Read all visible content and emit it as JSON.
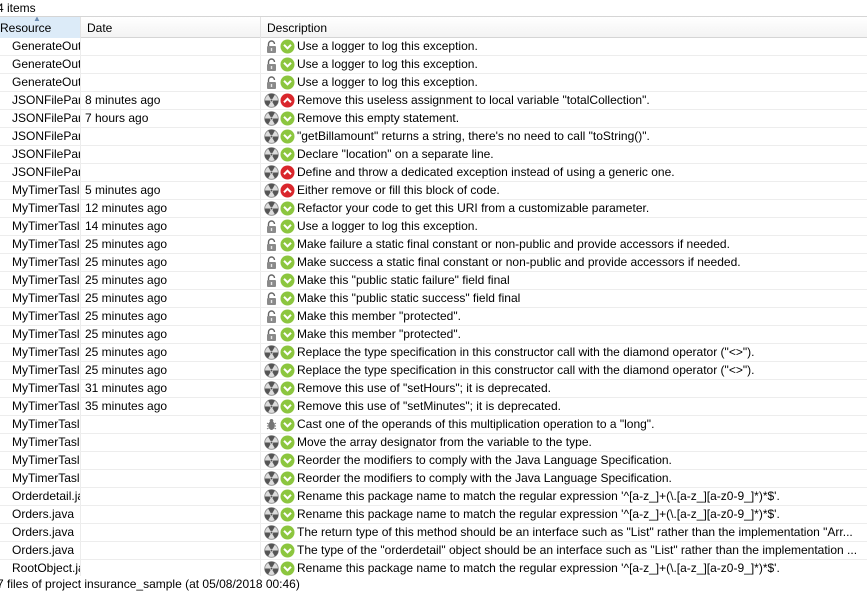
{
  "item_count": "4 items",
  "columns": {
    "resource": "Resource",
    "date": "Date",
    "description": "Description"
  },
  "rows": [
    {
      "resource": "GenerateOut",
      "date": "",
      "type": "lock-icon",
      "severity": "minor",
      "description": "Use a logger to log this exception."
    },
    {
      "resource": "GenerateOut",
      "date": "",
      "type": "lock-icon",
      "severity": "minor",
      "description": "Use a logger to log this exception."
    },
    {
      "resource": "GenerateOut",
      "date": "",
      "type": "lock-icon",
      "severity": "minor",
      "description": "Use a logger to log this exception."
    },
    {
      "resource": "JSONFilePars",
      "date": "8 minutes ago",
      "type": "radiation-icon",
      "severity": "major",
      "description": "Remove this useless assignment to local variable \"totalCollection\"."
    },
    {
      "resource": "JSONFilePars",
      "date": "7 hours ago",
      "type": "radiation-icon",
      "severity": "minor",
      "description": "Remove this empty statement."
    },
    {
      "resource": "JSONFilePars",
      "date": "",
      "type": "radiation-icon",
      "severity": "minor",
      "description": "\"getBillamount\" returns a string, there's no need to call \"toString()\"."
    },
    {
      "resource": "JSONFilePars",
      "date": "",
      "type": "radiation-icon",
      "severity": "minor",
      "description": "Declare \"location\" on a separate line."
    },
    {
      "resource": "JSONFilePars",
      "date": "",
      "type": "radiation-icon",
      "severity": "major",
      "description": "Define and throw a dedicated exception instead of using a generic one."
    },
    {
      "resource": "MyTimerTasl",
      "date": "5 minutes ago",
      "type": "radiation-icon",
      "severity": "major",
      "description": "Either remove or fill this block of code."
    },
    {
      "resource": "MyTimerTasl",
      "date": "12 minutes ago",
      "type": "radiation-icon",
      "severity": "minor",
      "description": "Refactor your code to get this URI from a customizable parameter."
    },
    {
      "resource": "MyTimerTasl",
      "date": "14 minutes ago",
      "type": "lock-icon",
      "severity": "minor",
      "description": "Use a logger to log this exception."
    },
    {
      "resource": "MyTimerTasl",
      "date": "25 minutes ago",
      "type": "lock-icon",
      "severity": "minor",
      "description": "Make failure a static final constant or non-public and provide accessors if needed."
    },
    {
      "resource": "MyTimerTasl",
      "date": "25 minutes ago",
      "type": "lock-icon",
      "severity": "minor",
      "description": "Make success a static final constant or non-public and provide accessors if needed."
    },
    {
      "resource": "MyTimerTasl",
      "date": "25 minutes ago",
      "type": "lock-icon",
      "severity": "minor",
      "description": "Make this \"public static failure\" field final"
    },
    {
      "resource": "MyTimerTasl",
      "date": "25 minutes ago",
      "type": "lock-icon",
      "severity": "minor",
      "description": "Make this \"public static success\" field final"
    },
    {
      "resource": "MyTimerTasl",
      "date": "25 minutes ago",
      "type": "lock-icon",
      "severity": "minor",
      "description": "Make this member \"protected\"."
    },
    {
      "resource": "MyTimerTasl",
      "date": "25 minutes ago",
      "type": "lock-icon",
      "severity": "minor",
      "description": "Make this member \"protected\"."
    },
    {
      "resource": "MyTimerTasl",
      "date": "25 minutes ago",
      "type": "radiation-icon",
      "severity": "minor",
      "description": "Replace the type specification in this constructor call with the diamond operator (\"<>\")."
    },
    {
      "resource": "MyTimerTasl",
      "date": "25 minutes ago",
      "type": "radiation-icon",
      "severity": "minor",
      "description": "Replace the type specification in this constructor call with the diamond operator (\"<>\")."
    },
    {
      "resource": "MyTimerTasl",
      "date": "31 minutes ago",
      "type": "radiation-icon",
      "severity": "minor",
      "description": "Remove this use of \"setHours\"; it is deprecated."
    },
    {
      "resource": "MyTimerTasl",
      "date": "35 minutes ago",
      "type": "radiation-icon",
      "severity": "minor",
      "description": "Remove this use of \"setMinutes\"; it is deprecated."
    },
    {
      "resource": "MyTimerTasl",
      "date": "",
      "type": "bug-icon",
      "severity": "minor",
      "description": "Cast one of the operands of this multiplication operation to a \"long\"."
    },
    {
      "resource": "MyTimerTasl",
      "date": "",
      "type": "radiation-icon",
      "severity": "minor",
      "description": "Move the array designator from the variable to the type."
    },
    {
      "resource": "MyTimerTasl",
      "date": "",
      "type": "radiation-icon",
      "severity": "minor",
      "description": "Reorder the modifiers to comply with the Java Language Specification."
    },
    {
      "resource": "MyTimerTasl",
      "date": "",
      "type": "radiation-icon",
      "severity": "minor",
      "description": "Reorder the modifiers to comply with the Java Language Specification."
    },
    {
      "resource": "Orderdetail.ja",
      "date": "",
      "type": "radiation-icon",
      "severity": "minor",
      "description": "Rename this package name to match the regular expression '^[a-z_]+(\\.[a-z_][a-z0-9_]*)*$'."
    },
    {
      "resource": "Orders.java",
      "date": "",
      "type": "radiation-icon",
      "severity": "minor",
      "description": "Rename this package name to match the regular expression '^[a-z_]+(\\.[a-z_][a-z0-9_]*)*$'."
    },
    {
      "resource": "Orders.java",
      "date": "",
      "type": "radiation-icon",
      "severity": "minor",
      "description": "The return type of this method should be an interface such as \"List\" rather than the implementation \"Arr..."
    },
    {
      "resource": "Orders.java",
      "date": "",
      "type": "radiation-icon",
      "severity": "minor",
      "description": "The type of the \"orderdetail\" object should be an interface such as \"List\" rather than the implementation ..."
    },
    {
      "resource": "RootObject.ja",
      "date": "",
      "type": "radiation-icon",
      "severity": "minor",
      "description": "Rename this package name to match the regular expression '^[a-z_]+(\\.[a-z_][a-z0-9_]*)*$'."
    }
  ],
  "status": "7 files of project insurance_sample (at 05/08/2018 00:46)",
  "colors": {
    "minor": "#8cc63f",
    "major": "#d9262c",
    "header_selected": "#dcebf8"
  }
}
